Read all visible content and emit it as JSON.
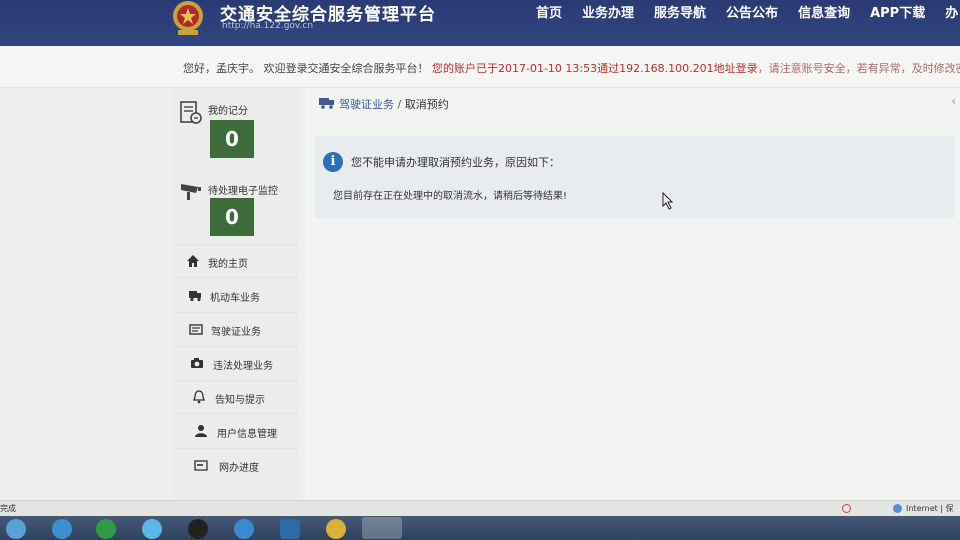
{
  "header": {
    "site_title": "交通安全综合服务管理平台",
    "site_url": "http://ha.122.gov.cn",
    "nav": [
      "首页",
      "业务办理",
      "服务导航",
      "公告公布",
      "信息查询",
      "APP下载",
      "办"
    ]
  },
  "welcome": {
    "greeting": "您好，孟庆宇。 欢迎登录交通安全综合服务平台！",
    "login_notice": "您的账户已于2017-01-10 13:53通过192.168.100.201地址登录",
    "advice": "，请注意账号安全，若有异常，及时修改密码"
  },
  "sidebar": {
    "score_label": "我的记分",
    "score_value": "0",
    "pending_label": "待处理电子监控",
    "pending_value": "0",
    "items": [
      {
        "label": "我的主页",
        "icon": "home-icon"
      },
      {
        "label": "机动车业务",
        "icon": "truck-icon"
      },
      {
        "label": "驾驶证业务",
        "icon": "id-card-icon"
      },
      {
        "label": "违法处理业务",
        "icon": "camera-icon"
      },
      {
        "label": "告知与提示",
        "icon": "bell-icon"
      },
      {
        "label": "用户信息管理",
        "icon": "user-icon"
      },
      {
        "label": "网办进度",
        "icon": "progress-icon"
      }
    ]
  },
  "breadcrumb": {
    "section": "驾驶证业务",
    "separator": "/",
    "page": "取消预约"
  },
  "alert": {
    "title": "您不能申请办理取消预约业务，原因如下：",
    "body": "您目前存在正在处理中的取消流水，请稍后等待结果!"
  },
  "statusbar": {
    "left": "完成",
    "zone": "Internet | 保"
  },
  "colors": {
    "header_bg": "#2a3a73",
    "counter_bg": "#3d6b3a",
    "info_icon": "#2f6fb3",
    "notice_red": "#b8312f"
  }
}
